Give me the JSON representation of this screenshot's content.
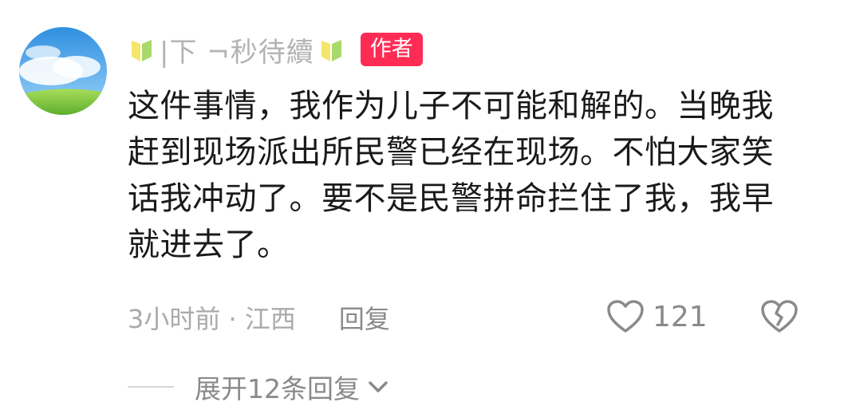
{
  "comment": {
    "username": "|下 ¬秒待續",
    "author_badge": "作者",
    "text": "这件事情，我作为儿子不可能和解的。当晚我赶到现场派出所民警已经在现场。不怕大家笑话我冲动了。要不是民警拼命拦住了我，我早就进去了。",
    "time_location": "3小时前 · 江西",
    "reply_label": "回复",
    "like_count": "121",
    "expand_replies_label": "展开12条回复"
  },
  "icons": {
    "avatar": "sky-clouds-grass-avatar",
    "username_decoration": "leaf-icon",
    "like": "heart-outline-icon",
    "dislike": "broken-heart-icon",
    "expand": "chevron-down-icon"
  },
  "colors": {
    "badge": "#fe2c55",
    "username": "#b3b3b3",
    "text": "#1a1a1a",
    "meta": "#aaaaaa",
    "action": "#8a8a8a"
  }
}
